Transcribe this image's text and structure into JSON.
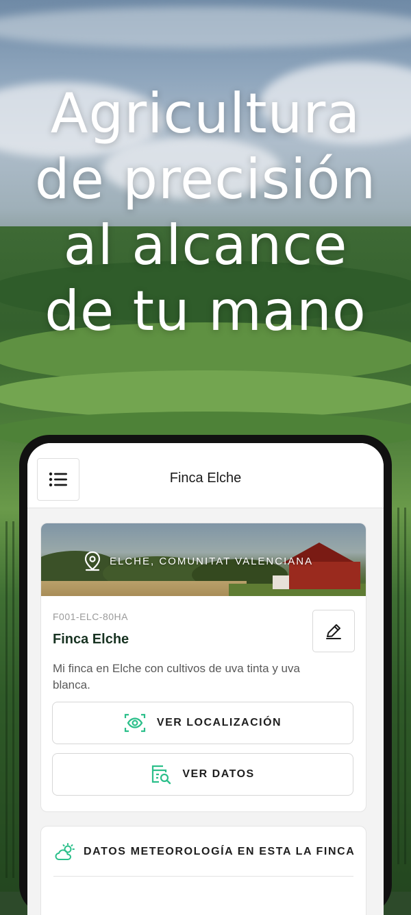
{
  "headline": {
    "lines": [
      "Agricultura",
      "de precisión",
      "al alcance",
      "de tu mano"
    ]
  },
  "app": {
    "title": "Finca Elche",
    "menu_icon": "hamburger-menu-icon"
  },
  "farm": {
    "location": "ELCHE, COMUNITAT VALENCIANA",
    "location_icon": "map-pin-icon",
    "code": "F001-ELC-80HA",
    "name": "Finca Elche",
    "description": "Mi finca en Elche con cultivos de uva tinta y uva blanca.",
    "edit_icon": "pencil-edit-icon",
    "buttons": {
      "location_label": "VER LOCALIZACIÓN",
      "location_icon": "eye-scan-icon",
      "data_label": "VER DATOS",
      "data_icon": "data-search-icon"
    }
  },
  "weather": {
    "title": "DATOS METEOROLOGÍA EN ESTA LA FINCA",
    "icon": "sun-cloud-icon"
  },
  "colors": {
    "accent": "#2bbf8a",
    "text_dark": "#183322",
    "barn_red": "#9a2a1e"
  }
}
